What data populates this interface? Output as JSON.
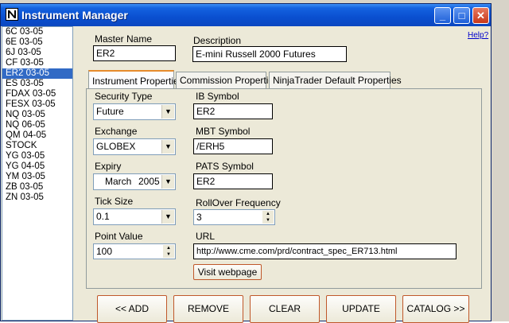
{
  "window": {
    "title": "Instrument Manager",
    "help_label": "Help?"
  },
  "instruments": [
    "6C 03-05",
    "6E 03-05",
    "6J 03-05",
    "CF 03-05",
    "ER2 03-05",
    "ES 03-05",
    "FDAX 03-05",
    "FESX 03-05",
    "NQ 03-05",
    "NQ 06-05",
    "QM 04-05",
    "STOCK",
    "YG 03-05",
    "YG 04-05",
    "YM 03-05",
    "ZB 03-05",
    "ZN 03-05"
  ],
  "selected_index": 4,
  "header": {
    "master_name_label": "Master Name",
    "master_name_value": "ER2",
    "description_label": "Description",
    "description_value": "E-mini Russell 2000 Futures"
  },
  "tabs": [
    "Instrument Properties",
    "Commission Properties",
    "NinjaTrader Default Properties"
  ],
  "props": {
    "security_type_label": "Security Type",
    "security_type_value": "Future",
    "exchange_label": "Exchange",
    "exchange_value": "GLOBEX",
    "expiry_label": "Expiry",
    "expiry_month": "March",
    "expiry_year": "2005",
    "tick_size_label": "Tick Size",
    "tick_size_value": "0.1",
    "point_value_label": "Point Value",
    "point_value_value": "100",
    "ib_symbol_label": "IB Symbol",
    "ib_symbol_value": "ER2",
    "mbt_symbol_label": "MBT  Symbol",
    "mbt_symbol_value": "/ERH5",
    "pats_symbol_label": "PATS Symbol",
    "pats_symbol_value": "ER2",
    "rollover_label": "RollOver Frequency",
    "rollover_value": "3",
    "url_label": "URL",
    "url_value": "http://www.cme.com/prd/contract_spec_ER713.html",
    "visit_label": "Visit webpage"
  },
  "buttons": {
    "add": "<< ADD",
    "remove": "REMOVE",
    "clear": "CLEAR",
    "update": "UPDATE",
    "catalog": "CATALOG >>"
  },
  "colors": {
    "selection": "#316ac5",
    "titlebar": "#0a4fd0",
    "button_border": "#c0582a"
  }
}
